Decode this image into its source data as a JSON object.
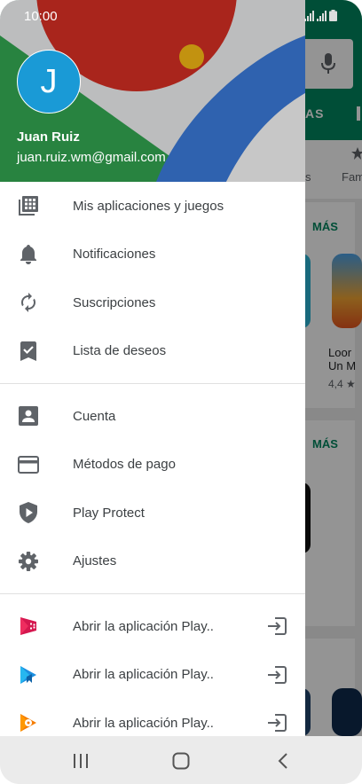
{
  "status_bar": {
    "time": "10:00"
  },
  "background_app": {
    "tab_partial": "AS",
    "chip_partial_1": "s",
    "chip_partial_2": "Fam",
    "section_more_1": "MÁS",
    "section_more_2": "MÁS",
    "app_title_line1": "Loor",
    "app_title_line2": "Un M",
    "app_rating": "4,4 ★"
  },
  "drawer": {
    "avatar_initial": "J",
    "user_name": "Juan Ruiz",
    "user_email": "juan.ruiz.wm@gmail.com",
    "menu_group_1": [
      {
        "label": "Mis aplicaciones y juegos",
        "icon": "apps-grid-icon"
      },
      {
        "label": "Notificaciones",
        "icon": "bell-icon"
      },
      {
        "label": "Suscripciones",
        "icon": "refresh-icon"
      },
      {
        "label": "Lista de deseos",
        "icon": "bookmark-check-icon"
      }
    ],
    "menu_group_2": [
      {
        "label": "Cuenta",
        "icon": "account-box-icon"
      },
      {
        "label": "Métodos de pago",
        "icon": "credit-card-icon"
      },
      {
        "label": "Play Protect",
        "icon": "shield-play-icon"
      },
      {
        "label": "Ajustes",
        "icon": "gear-icon"
      }
    ],
    "menu_group_3": [
      {
        "label": "Abrir la aplicación Play..",
        "icon": "play-movies-icon",
        "trailing": "open-external-icon"
      },
      {
        "label": "Abrir la aplicación Play..",
        "icon": "play-books-icon",
        "trailing": "open-external-icon"
      },
      {
        "label": "Abrir la aplicación Play..",
        "icon": "play-music-icon",
        "trailing": "open-external-icon"
      }
    ]
  },
  "nav_bar": {
    "recents": "recents-icon",
    "home": "home-icon",
    "back": "back-icon"
  },
  "colors": {
    "avatar": "#1a9ad6",
    "header_green": "#34a853",
    "header_red": "#d93025",
    "header_blue": "#3d7ee0",
    "header_yellow": "#f9bc15",
    "play_green": "#01875f"
  }
}
